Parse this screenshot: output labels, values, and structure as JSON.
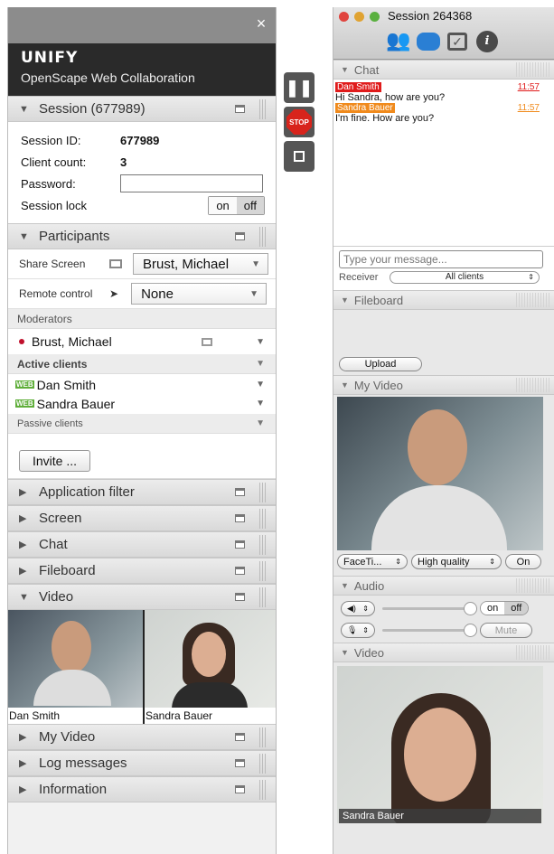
{
  "left": {
    "close_glyph": "×",
    "brand_logo": "UNIFY",
    "brand_sub": "OpenScape Web Collaboration",
    "session": {
      "header": "Session (677989)",
      "id_label": "Session ID:",
      "id_value": "677989",
      "count_label": "Client count:",
      "count_value": "3",
      "password_label": "Password:",
      "lock_label": "Session lock",
      "lock_on": "on",
      "lock_off": "off"
    },
    "participants": {
      "header": "Participants",
      "share_label": "Share Screen",
      "share_value": "Brust, Michael",
      "remote_label": "Remote control",
      "remote_value": "None",
      "moderators_label": "Moderators",
      "moderator_name": "Brust, Michael",
      "active_label": "Active clients",
      "active": [
        {
          "tag": "WEB",
          "name": "Dan Smith"
        },
        {
          "tag": "WEB",
          "name": "Sandra Bauer"
        }
      ],
      "passive_label": "Passive clients",
      "invite_label": "Invite ..."
    },
    "sections": {
      "app_filter": "Application filter",
      "screen": "Screen",
      "chat": "Chat",
      "fileboard": "Fileboard",
      "video": "Video",
      "my_video": "My Video",
      "log": "Log messages",
      "info": "Information"
    },
    "video_names": [
      "Dan Smith",
      "Sandra Bauer"
    ]
  },
  "middle": {
    "stop_label": "STOP"
  },
  "right": {
    "title": "Session 264368",
    "chat": {
      "header": "Chat",
      "messages": [
        {
          "from": "Dan Smith",
          "time": "11:57",
          "text": "Hi Sandra, how are you?",
          "color": "#e01b1b"
        },
        {
          "from": "Sandra Bauer",
          "time": "11:57",
          "text": "I'm fine. How are you?",
          "color": "#f08a1c"
        }
      ],
      "placeholder": "Type your message...",
      "receiver_label": "Receiver",
      "receiver_value": "All clients"
    },
    "fileboard": {
      "header": "Fileboard",
      "upload": "Upload"
    },
    "myvideo": {
      "header": "My Video",
      "camera": "FaceTi...",
      "quality": "High quality",
      "on": "On"
    },
    "audio": {
      "header": "Audio",
      "on": "on",
      "off": "off",
      "mute": "Mute"
    },
    "video": {
      "header": "Video",
      "name": "Sandra Bauer"
    }
  }
}
